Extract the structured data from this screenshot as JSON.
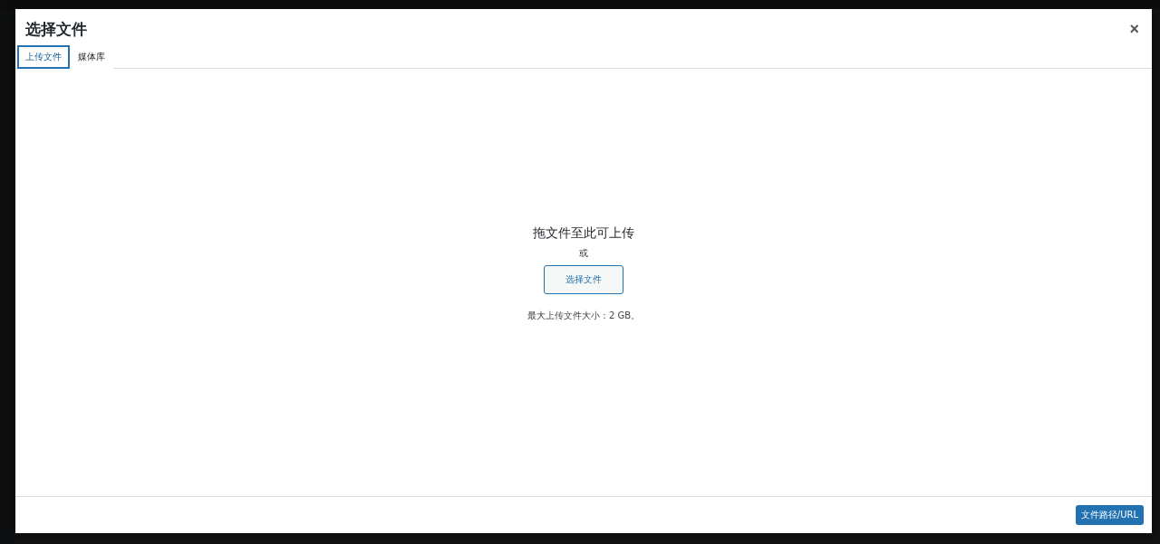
{
  "modal": {
    "title": "选择文件",
    "close": "×",
    "tabs": [
      {
        "label": "上传文件",
        "selected": true
      },
      {
        "label": "媒体库",
        "selected": false
      }
    ],
    "uploader": {
      "heading": "拖文件至此可上传",
      "or": "或",
      "button": "选择文件",
      "max_size": "最大上传文件大小：2 GB。"
    },
    "footer_button": "文件路径/URL"
  }
}
